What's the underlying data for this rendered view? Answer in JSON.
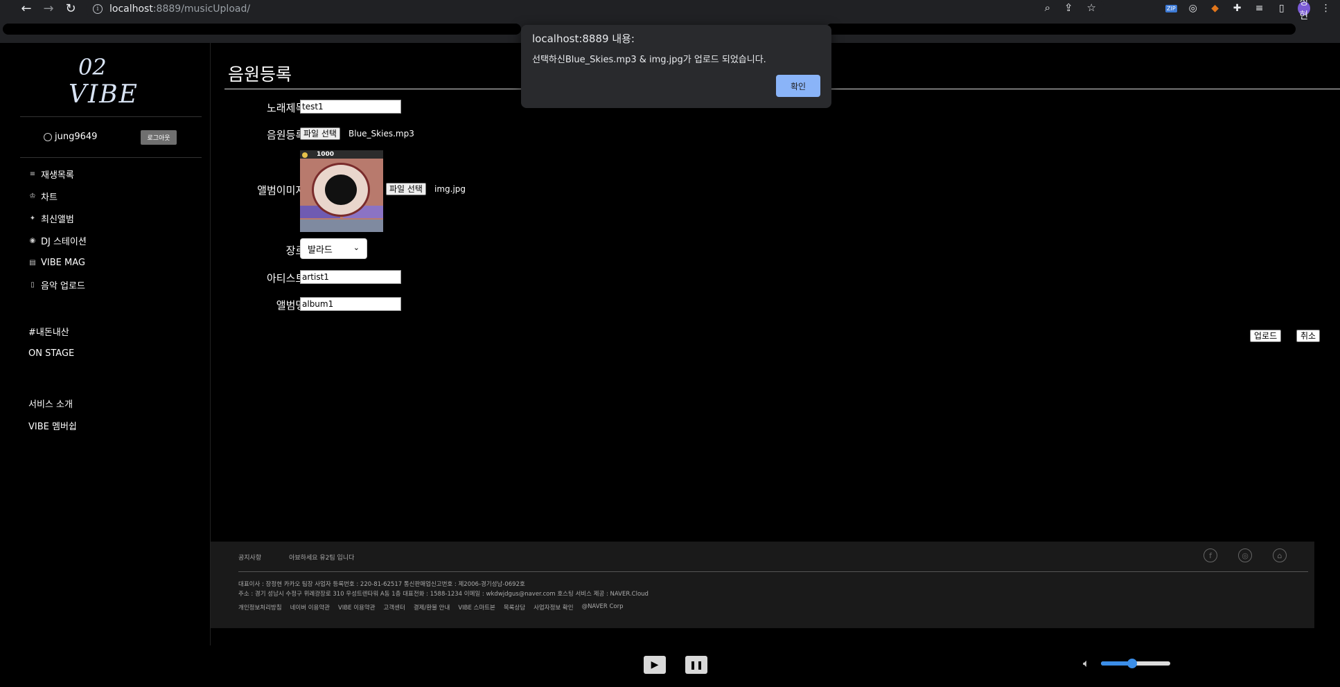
{
  "browser": {
    "url_host": "localhost",
    "url_rest": ":8889/musicUpload/",
    "profile_initials": "정현",
    "zip_label": "ZIP"
  },
  "sidebar": {
    "logo_top": "02",
    "logo_text": "VIBE",
    "username": "jung9649",
    "logout_label": "로그아웃",
    "nav_items": [
      {
        "label": "재생목록",
        "icon": "playlist-icon"
      },
      {
        "label": "차트",
        "icon": "trophy-icon"
      },
      {
        "label": "최신앨범",
        "icon": "sparkle-icon"
      },
      {
        "label": "DJ 스테이션",
        "icon": "radio-icon"
      },
      {
        "label": "VIBE MAG",
        "icon": "magazine-icon"
      },
      {
        "label": "음악 업로드",
        "icon": "upload-file-icon"
      }
    ],
    "links_group1": [
      "#내돈내산",
      "ON STAGE"
    ],
    "links_group2": [
      "서비스 소개",
      "VIBE 멤버쉽"
    ]
  },
  "main": {
    "title": "음원등록",
    "fields": {
      "song_title_label": "노래제목 :",
      "song_title_value": "test1",
      "audio_label": "음원등록 :",
      "audio_button": "파일 선택",
      "audio_file": "Blue_Skies.mp3",
      "image_label": "앨범이미지 :",
      "image_button": "파일 선택",
      "image_file": "img.jpg",
      "image_amount": "1000",
      "genre_label": "장르 :",
      "genre_value": "발라드",
      "artist_label": "아티스트 :",
      "artist_value": "artist1",
      "album_label": "앨범명 :",
      "album_value": "album1"
    },
    "upload_button": "업로드",
    "cancel_button": "취소"
  },
  "footer": {
    "notice": "공지사항",
    "notice_msg": "아뵤하세요 유2팀 입니다",
    "info_line1": "대표이사 : 장정현 카카오 팀장    사업자 등록번호 : 220-81-62517    통신판매업신고번호 : 제2006-경기성남-0692호",
    "info_line2": "주소 : 경기 성남시 수정구 위례광장로 310 우성트렌타워 A동 1층    대표전화 : 1588-1234    이메일 : wkdwjdgus@naver.com    호스팅 서비스 제공 : NAVER.Cloud",
    "links": [
      "개인정보처리방침",
      "네이버 이용약관",
      "VIBE 이용약관",
      "고객센터",
      "결제/환불 안내",
      "VIBE 스마트본",
      "목록상담",
      "사업자정보 확인",
      "@NAVER Corp"
    ]
  },
  "player": {
    "volume_percent": 45
  },
  "dialog": {
    "title": "localhost:8889 내용:",
    "message": "선택하신Blue_Skies.mp3 & img.jpg가 업로드 되었습니다.",
    "ok_label": "확인"
  },
  "colors": {
    "dialog_ok": "#8ab4f8",
    "volume_accent": "#3b8ee8"
  }
}
